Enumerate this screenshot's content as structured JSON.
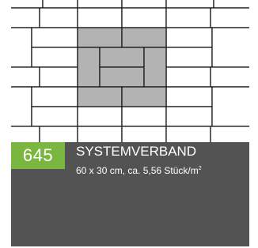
{
  "product": {
    "code": "645",
    "name": "SYSTEMVERBAND",
    "spec": "60 x 30 cm, ca. 5,56 Stück/m",
    "spec_sup": "2"
  },
  "colors": {
    "accent": "#7bb640",
    "footer": "#535353",
    "stone_white": "#ffffff",
    "stone_grey": "#b3b3b3",
    "joint": "#1a1a1a"
  },
  "pattern": {
    "layout": "paving-stone laying pattern (Systemverband) with a highlighted grey repeat unit"
  }
}
